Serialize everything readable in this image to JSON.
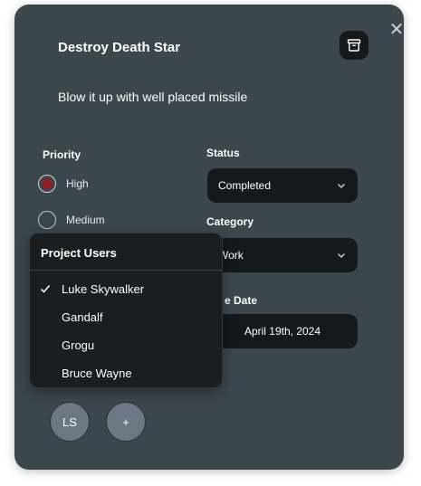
{
  "task": {
    "title": "Destroy Death Star",
    "description": "Blow it up with well placed missile"
  },
  "priority": {
    "label": "Priority",
    "options": [
      {
        "label": "High",
        "checked": true,
        "color": "#8e1f26"
      },
      {
        "label": "Medium",
        "checked": false
      }
    ]
  },
  "status": {
    "label": "Status",
    "value": "Completed"
  },
  "category": {
    "label": "Category",
    "value": "Work"
  },
  "due_date": {
    "label_visible": "e Date",
    "value": "April 19th, 2024"
  },
  "users_dropdown": {
    "title": "Project Users",
    "items": [
      {
        "label": "Luke Skywalker",
        "checked": true
      },
      {
        "label": "Gandalf",
        "checked": false
      },
      {
        "label": "Grogu",
        "checked": false
      },
      {
        "label": "Bruce Wayne",
        "checked": false
      }
    ]
  },
  "avatars": {
    "assigned_initials": "LS",
    "add_label": "+"
  },
  "icons": {
    "close": "close-icon",
    "archive": "archive-icon",
    "chevron": "chevron-down-icon",
    "check": "check-icon"
  },
  "colors": {
    "modal_bg": "#3b464d",
    "control_bg": "#15191b",
    "dropdown_bg": "#1b1d1f",
    "avatar_bg": "#6c7785",
    "priority_high": "#8e1f26"
  }
}
